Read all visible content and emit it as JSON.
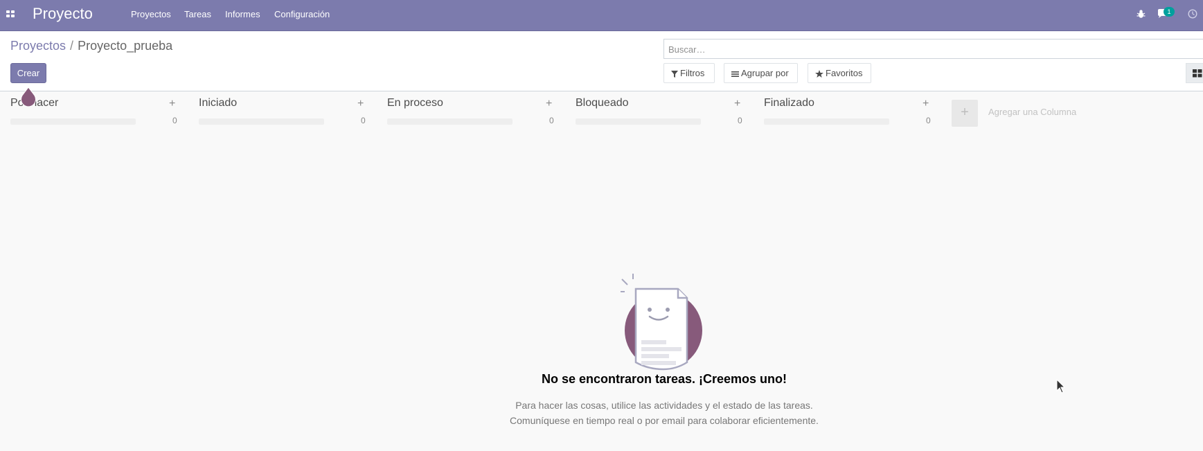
{
  "navbar": {
    "app_title": "Proyecto",
    "menu": [
      "Proyectos",
      "Tareas",
      "Informes",
      "Configuración"
    ],
    "messages_count": "1",
    "accent_color": "#7c7bad"
  },
  "breadcrumb": {
    "parent": "Proyectos",
    "separator": "/",
    "current": "Proyecto_prueba"
  },
  "toolbar": {
    "create_label": "Crear",
    "search_placeholder": "Buscar…",
    "filters_label": "Filtros",
    "group_by_label": "Agrupar por",
    "favorites_label": "Favoritos"
  },
  "kanban": {
    "columns": [
      {
        "title": "Por hacer",
        "count": "0"
      },
      {
        "title": "Iniciado",
        "count": "0"
      },
      {
        "title": "En proceso",
        "count": "0"
      },
      {
        "title": "Bloqueado",
        "count": "0"
      },
      {
        "title": "Finalizado",
        "count": "0"
      }
    ],
    "add_column_label": "Agregar una Columna"
  },
  "empty_state": {
    "title": "No se encontraron tareas. ¡Creemos uno!",
    "line1": "Para hacer las cosas, utilice las actividades y el estado de las tareas.",
    "line2": "Comuníquese en tiempo real o por email para colaborar eficientemente."
  }
}
